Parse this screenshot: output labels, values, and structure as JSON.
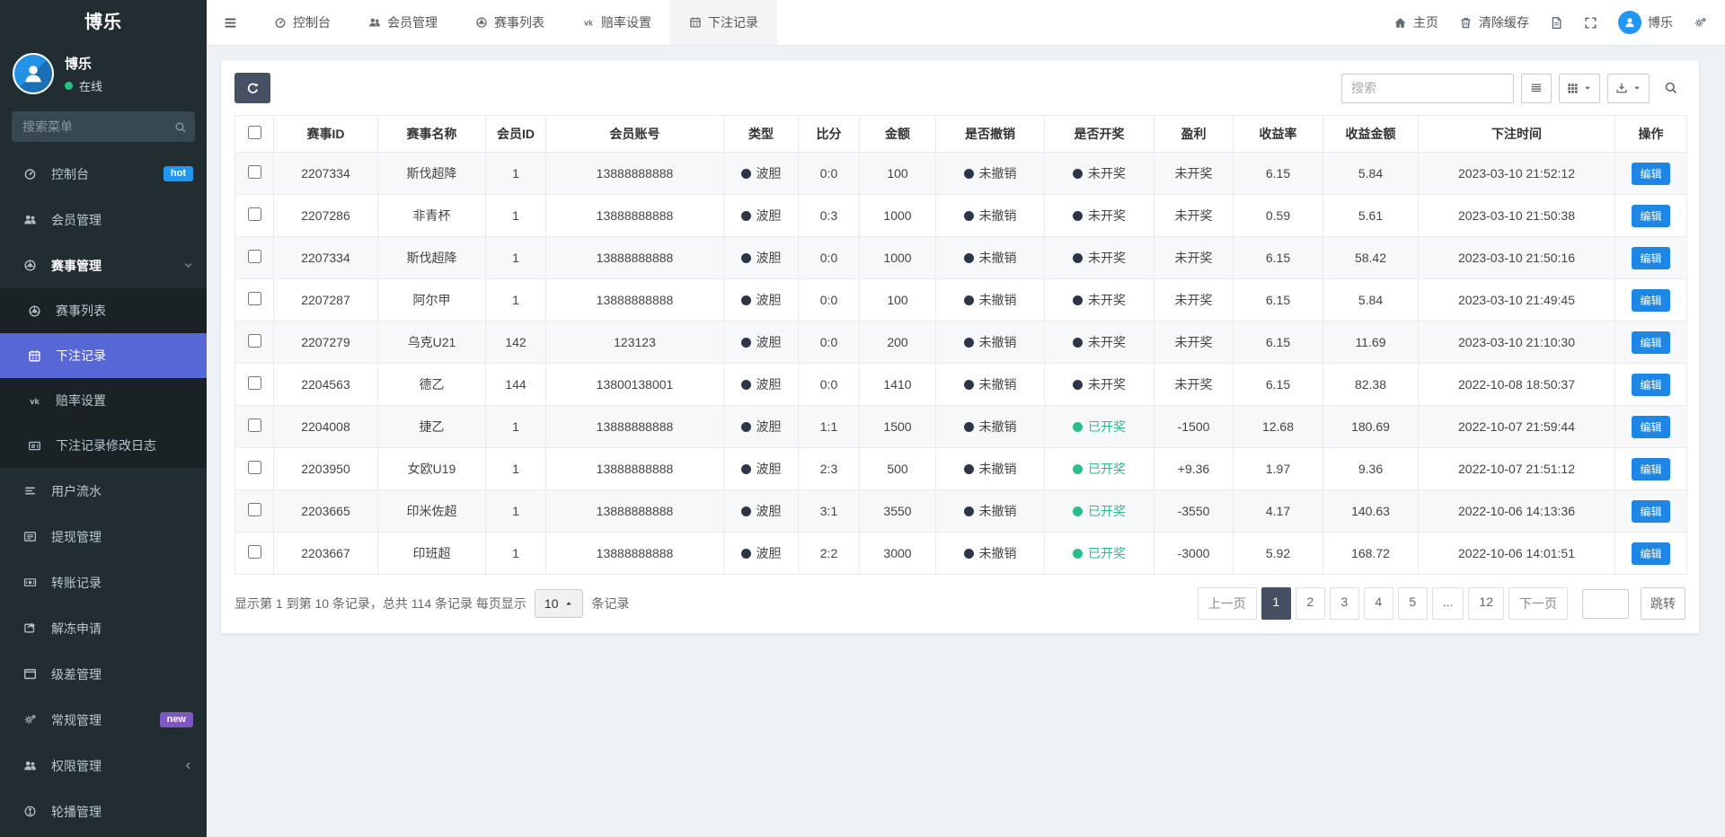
{
  "app": {
    "brand": "博乐"
  },
  "sidebar": {
    "user": {
      "name": "博乐",
      "status": "在线"
    },
    "search_placeholder": "搜索菜单",
    "menu": [
      {
        "key": "dashboard",
        "icon": "gauge",
        "label": "控制台",
        "badge": "hot",
        "badge_color": "#2196f3"
      },
      {
        "key": "members",
        "icon": "users",
        "label": "会员管理"
      },
      {
        "key": "matches",
        "icon": "ball",
        "label": "赛事管理",
        "expanded": true,
        "children": [
          {
            "key": "match-list",
            "icon": "ball",
            "label": "赛事列表"
          },
          {
            "key": "bet-records",
            "icon": "calendar",
            "label": "下注记录",
            "active": true
          },
          {
            "key": "odds-settings",
            "icon": "vk",
            "label": "赔率设置"
          },
          {
            "key": "bet-edit-log",
            "icon": "news",
            "label": "下注记录修改日志"
          }
        ]
      },
      {
        "key": "user-flow",
        "icon": "bars",
        "label": "用户流水"
      },
      {
        "key": "withdrawals",
        "icon": "listalt",
        "label": "提现管理"
      },
      {
        "key": "transfers",
        "icon": "money",
        "label": "转账记录"
      },
      {
        "key": "unfreeze-requests",
        "icon": "share",
        "label": "解冻申请"
      },
      {
        "key": "level-diff",
        "icon": "window",
        "label": "级差管理"
      },
      {
        "key": "general",
        "icon": "gears",
        "label": "常规管理",
        "badge": "new",
        "badge_color": "#7e57c2"
      },
      {
        "key": "permissions",
        "icon": "users",
        "label": "权限管理",
        "collapsed": true
      },
      {
        "key": "carousel",
        "icon": "carousel",
        "label": "轮播管理"
      }
    ]
  },
  "topbar": {
    "tabs": [
      {
        "key": "dashboard",
        "icon": "gauge",
        "label": "控制台"
      },
      {
        "key": "members",
        "icon": "users",
        "label": "会员管理"
      },
      {
        "key": "match-list",
        "icon": "ball",
        "label": "赛事列表"
      },
      {
        "key": "odds-settings",
        "icon": "vk",
        "label": "赔率设置"
      },
      {
        "key": "bet-records",
        "icon": "calendar",
        "label": "下注记录",
        "active": true
      }
    ],
    "right": [
      {
        "key": "home",
        "icon": "home",
        "label": "主页"
      },
      {
        "key": "clear-cache",
        "icon": "trash",
        "label": "清除缓存"
      },
      {
        "key": "notes",
        "icon": "doc",
        "label": ""
      },
      {
        "key": "fullscreen",
        "icon": "expand",
        "label": ""
      },
      {
        "key": "user",
        "icon": "person",
        "label": "博乐",
        "avatar": true
      },
      {
        "key": "settings",
        "icon": "gears",
        "label": ""
      }
    ]
  },
  "toolbar": {
    "search_placeholder": "搜索"
  },
  "table": {
    "columns": [
      "赛事ID",
      "赛事名称",
      "会员ID",
      "会员账号",
      "类型",
      "比分",
      "金额",
      "是否撤销",
      "是否开奖",
      "盈利",
      "收益率",
      "收益金额",
      "下注时间",
      "操作"
    ],
    "col_keys": [
      "event-id",
      "event-name",
      "member-id",
      "account",
      "type",
      "score",
      "amount",
      "cancel-status",
      "draw-status",
      "profit",
      "rate",
      "income",
      "bet-time",
      "action"
    ],
    "edit_label": "编辑",
    "rows": [
      {
        "event_id": "2207334",
        "event_name": "斯伐超降",
        "member_id": "1",
        "account": "13888888888",
        "type": "波胆",
        "score": "0:0",
        "amount": "100",
        "cancel": "未撤销",
        "draw": "未开奖",
        "drawn": false,
        "profit": "未开奖",
        "rate": "6.15",
        "income": "5.84",
        "time": "2023-03-10 21:52:12"
      },
      {
        "event_id": "2207286",
        "event_name": "非青杯",
        "member_id": "1",
        "account": "13888888888",
        "type": "波胆",
        "score": "0:3",
        "amount": "1000",
        "cancel": "未撤销",
        "draw": "未开奖",
        "drawn": false,
        "profit": "未开奖",
        "rate": "0.59",
        "income": "5.61",
        "time": "2023-03-10 21:50:38"
      },
      {
        "event_id": "2207334",
        "event_name": "斯伐超降",
        "member_id": "1",
        "account": "13888888888",
        "type": "波胆",
        "score": "0:0",
        "amount": "1000",
        "cancel": "未撤销",
        "draw": "未开奖",
        "drawn": false,
        "profit": "未开奖",
        "rate": "6.15",
        "income": "58.42",
        "time": "2023-03-10 21:50:16"
      },
      {
        "event_id": "2207287",
        "event_name": "阿尔甲",
        "member_id": "1",
        "account": "13888888888",
        "type": "波胆",
        "score": "0:0",
        "amount": "100",
        "cancel": "未撤销",
        "draw": "未开奖",
        "drawn": false,
        "profit": "未开奖",
        "rate": "6.15",
        "income": "5.84",
        "time": "2023-03-10 21:49:45"
      },
      {
        "event_id": "2207279",
        "event_name": "乌克U21",
        "member_id": "142",
        "account": "123123",
        "type": "波胆",
        "score": "0:0",
        "amount": "200",
        "cancel": "未撤销",
        "draw": "未开奖",
        "drawn": false,
        "profit": "未开奖",
        "rate": "6.15",
        "income": "11.69",
        "time": "2023-03-10 21:10:30"
      },
      {
        "event_id": "2204563",
        "event_name": "德乙",
        "member_id": "144",
        "account": "13800138001",
        "type": "波胆",
        "score": "0:0",
        "amount": "1410",
        "cancel": "未撤销",
        "draw": "未开奖",
        "drawn": false,
        "profit": "未开奖",
        "rate": "6.15",
        "income": "82.38",
        "time": "2022-10-08 18:50:37"
      },
      {
        "event_id": "2204008",
        "event_name": "捷乙",
        "member_id": "1",
        "account": "13888888888",
        "type": "波胆",
        "score": "1:1",
        "amount": "1500",
        "cancel": "未撤销",
        "draw": "已开奖",
        "drawn": true,
        "profit": "-1500",
        "rate": "12.68",
        "income": "180.69",
        "time": "2022-10-07 21:59:44"
      },
      {
        "event_id": "2203950",
        "event_name": "女欧U19",
        "member_id": "1",
        "account": "13888888888",
        "type": "波胆",
        "score": "2:3",
        "amount": "500",
        "cancel": "未撤销",
        "draw": "已开奖",
        "drawn": true,
        "profit": "+9.36",
        "rate": "1.97",
        "income": "9.36",
        "time": "2022-10-07 21:51:12"
      },
      {
        "event_id": "2203665",
        "event_name": "印米佐超",
        "member_id": "1",
        "account": "13888888888",
        "type": "波胆",
        "score": "3:1",
        "amount": "3550",
        "cancel": "未撤销",
        "draw": "已开奖",
        "drawn": true,
        "profit": "-3550",
        "rate": "4.17",
        "income": "140.63",
        "time": "2022-10-06 14:13:36"
      },
      {
        "event_id": "2203667",
        "event_name": "印班超",
        "member_id": "1",
        "account": "13888888888",
        "type": "波胆",
        "score": "2:2",
        "amount": "3000",
        "cancel": "未撤销",
        "draw": "已开奖",
        "drawn": true,
        "profit": "-3000",
        "rate": "5.92",
        "income": "168.72",
        "time": "2022-10-06 14:01:51"
      }
    ]
  },
  "pagination": {
    "info_prefix": "显示第 1 到第 10 条记录，总共 114 条记录 每页显示",
    "page_size": "10",
    "info_suffix": "条记录",
    "prev": "上一页",
    "next": "下一页",
    "pages": [
      "1",
      "2",
      "3",
      "4",
      "5",
      "...",
      "12"
    ],
    "active_page": "1",
    "jump": "跳转"
  },
  "colors": {
    "sidebar_bg": "#222d32",
    "submenu_bg": "#1a2226",
    "active_item": "#5867d6",
    "hot_badge": "#2196f3",
    "new_badge": "#7e57c2",
    "online_dot": "#26c281",
    "refresh_button": "#474f63",
    "edit_button": "#1e87e5",
    "status_dark_dot": "#2b3648",
    "status_green": "#2bbe8d"
  }
}
